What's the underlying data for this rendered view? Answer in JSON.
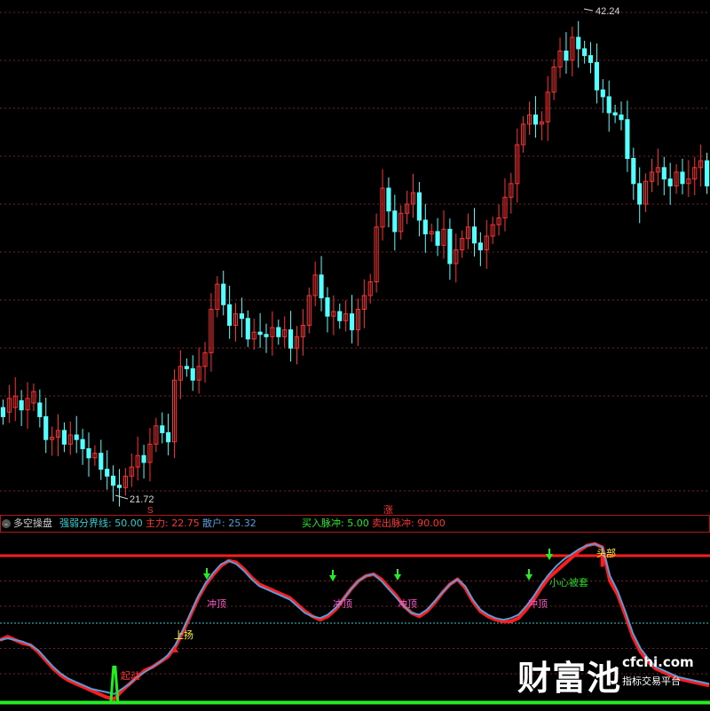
{
  "colors": {
    "up": "#ff3232",
    "down": "#54ffff",
    "grid": "#7a1e1e",
    "border": "#b01818",
    "main": "#ff1c1c",
    "retail": "#5a9bd8",
    "boundary": "#33cccc",
    "signal": "#22ee22",
    "label_pink": "#ff55cc",
    "label_yellow": "#ffee33",
    "label_green": "#22dd22"
  },
  "price_panel": {
    "high_label": "42.24",
    "low_label": "21.72",
    "mark_s": "S",
    "mark_zhang": "涨"
  },
  "legend": {
    "icon": "⌄",
    "name": "多空操盘",
    "boundary_label": "强弱分界线: 50.00",
    "main_label": "主力: 22.75",
    "retail_label": "散户: 25.32",
    "buy_label": "买入脉冲: 5.00",
    "sell_label": "卖出脉冲: 90.00"
  },
  "annotations": {
    "qidong": "起动",
    "shangyang": "上扬",
    "chongding": "冲顶",
    "xiaoxin": "小心被套",
    "toubu": "头部"
  },
  "watermark": {
    "main": "财富池",
    "site": "cfchi.com",
    "sub": "指标交易平台"
  },
  "chart_data": [
    {
      "type": "candlestick",
      "high_label": 42.24,
      "low_label": 21.72,
      "ylim": [
        20.9,
        43.0
      ],
      "close": [
        25.0,
        25.8,
        25.9,
        25.3,
        25.8,
        26.1,
        25.0,
        24.0,
        24.1,
        24.4,
        23.8,
        24.2,
        24.0,
        23.6,
        23.2,
        23.4,
        22.7,
        22.4,
        22.0,
        21.9,
        22.4,
        22.8,
        23.3,
        23.0,
        23.8,
        24.6,
        24.3,
        23.9,
        26.6,
        27.2,
        27.1,
        26.6,
        27.2,
        27.8,
        29.7,
        30.8,
        29.9,
        29.0,
        29.5,
        29.3,
        28.4,
        28.7,
        28.6,
        28.5,
        28.9,
        28.5,
        28.8,
        28.0,
        28.5,
        29.0,
        30.3,
        31.2,
        30.2,
        29.4,
        29.6,
        29.2,
        29.5,
        28.8,
        29.7,
        30.3,
        30.9,
        33.3,
        35.0,
        34.0,
        33.1,
        33.9,
        34.3,
        34.8,
        33.6,
        33.0,
        33.1,
        32.5,
        33.2,
        31.7,
        32.3,
        32.8,
        33.3,
        32.6,
        32.3,
        32.9,
        33.4,
        33.7,
        34.6,
        35.2,
        36.9,
        37.8,
        38.2,
        37.8,
        37.9,
        39.2,
        40.3,
        41.0,
        40.6,
        41.6,
        41.1,
        40.8,
        40.5,
        39.3,
        39.0,
        38.3,
        38.2,
        38.0,
        36.3,
        35.2,
        34.3,
        35.3,
        35.7,
        35.9,
        35.4,
        35.1,
        35.7,
        35.2,
        35.4,
        35.9,
        36.2,
        35.1
      ],
      "open_offset_note": "",
      "open": [
        25.4,
        25.2,
        25.4,
        25.7,
        25.3,
        25.6,
        25.6,
        25.0,
        24.0,
        24.1,
        24.4,
        23.8,
        24.2,
        24.0,
        23.6,
        23.2,
        23.4,
        22.7,
        22.4,
        22.0,
        21.9,
        22.4,
        22.8,
        23.3,
        23.0,
        23.8,
        24.6,
        24.3,
        23.9,
        26.6,
        27.2,
        27.1,
        26.6,
        27.2,
        27.8,
        29.7,
        30.8,
        29.9,
        29.0,
        29.5,
        29.3,
        28.4,
        28.7,
        28.6,
        28.5,
        28.9,
        28.5,
        28.8,
        28.0,
        28.5,
        29.0,
        30.3,
        31.2,
        30.2,
        29.4,
        29.6,
        29.2,
        29.5,
        28.8,
        29.7,
        30.3,
        30.9,
        33.3,
        35.0,
        34.0,
        33.1,
        33.9,
        34.3,
        34.8,
        33.6,
        33.0,
        33.1,
        32.5,
        33.2,
        31.7,
        32.3,
        32.8,
        33.3,
        32.6,
        32.3,
        32.9,
        33.4,
        33.7,
        34.6,
        35.2,
        36.9,
        37.8,
        38.2,
        37.8,
        37.9,
        39.2,
        40.3,
        41.0,
        40.6,
        41.6,
        41.1,
        40.8,
        40.5,
        39.3,
        39.0,
        38.3,
        38.2,
        38.0,
        36.3,
        35.2,
        34.3,
        35.3,
        35.7,
        35.9,
        35.4,
        35.1,
        35.7,
        35.2,
        35.4,
        35.9,
        36.2
      ]
    },
    {
      "type": "line",
      "ylim": [
        0,
        100
      ],
      "boundary": 50,
      "buy_pulse": 5,
      "sell_pulse": 90,
      "main": [
        40,
        42,
        40,
        38,
        37,
        33,
        28,
        23,
        19,
        16,
        14,
        12,
        10,
        8,
        6,
        5,
        10,
        14,
        18,
        22,
        24,
        27,
        30,
        36,
        45,
        55,
        65,
        73,
        79,
        84,
        87,
        86,
        82,
        77,
        73,
        71,
        69,
        67,
        65,
        61,
        57,
        54,
        52,
        54,
        58,
        64,
        70,
        75,
        78,
        79,
        76,
        71,
        66,
        60,
        56,
        54,
        57,
        62,
        68,
        73,
        76,
        71,
        63,
        57,
        54,
        52,
        51,
        51,
        53,
        58,
        64,
        71,
        77,
        81,
        85,
        89,
        93,
        96,
        97,
        95,
        75,
        67,
        55,
        42,
        33,
        27,
        23,
        21,
        19,
        17,
        16,
        15,
        14,
        13
      ],
      "retail": [
        40,
        41,
        40,
        39,
        37,
        34,
        29,
        24,
        20,
        17,
        15,
        13,
        11,
        10,
        9,
        8,
        11,
        14,
        18,
        21,
        24,
        27,
        31,
        37,
        46,
        56,
        66,
        74,
        80,
        85,
        87,
        85,
        81,
        76,
        72,
        70,
        68,
        66,
        64,
        60,
        56,
        54,
        53,
        55,
        59,
        64,
        70,
        75,
        78,
        79,
        75,
        70,
        65,
        60,
        56,
        55,
        58,
        63,
        68,
        73,
        76,
        72,
        64,
        58,
        55,
        53,
        52,
        53,
        55,
        60,
        66,
        73,
        79,
        84,
        88,
        91,
        94,
        96,
        97,
        95,
        78,
        69,
        57,
        44,
        35,
        29,
        24,
        22,
        20,
        18,
        17,
        16,
        15,
        14
      ],
      "signal_spike_index": 15,
      "signal_spike_value": 24
    }
  ]
}
